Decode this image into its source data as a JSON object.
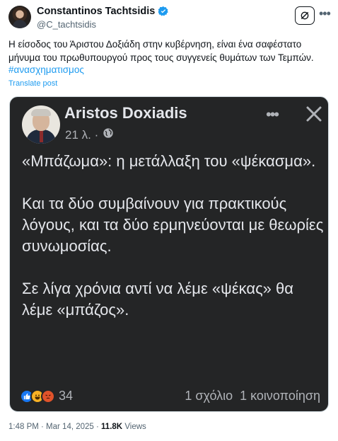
{
  "tweet": {
    "author_name": "Constantinos Tachtsidis",
    "handle": "@C_tachtsidis",
    "text": "Η είσοδος του Άριστου Δοξιάδη στην κυβέρνηση, είναι ένα σαφέστατο μήνυμα του πρωθυπουργού προς τους συγγενείς θυμάτων των Τεμπών.",
    "hashtag": "#ανασχηματισμος",
    "translate_label": "Translate post",
    "more_icon": "more-horizontal-icon",
    "grok_icon": "grok-icon",
    "verified_color": "#1d9bf0",
    "timestamp": "1:48 PM · Mar 14, 2025 · ",
    "views_count": "11.8K",
    "views_label": "Views"
  },
  "facebook_post": {
    "author_name": "Aristos Doxiadis",
    "time_ago": "21 λ. ·",
    "privacy_icon": "globe-icon",
    "paragraphs": [
      "«Μπάζωμα»: η μετάλλαξη του «ψέκασμα».",
      "Και τα δύο συμβαίνουν για πρακτικούς λόγους, και τα δύο ερμηνεύονται με θεωρίες συνωμοσίας.",
      "Σε λίγα χρόνια αντί να λέμε «ψέκας» θα λέμε «μπάζος»."
    ],
    "reaction_count": "34",
    "comments": "1 σχόλιο",
    "shares": "1 κοινοποίηση",
    "background": "#242526",
    "text_color": "#e4e6eb"
  }
}
